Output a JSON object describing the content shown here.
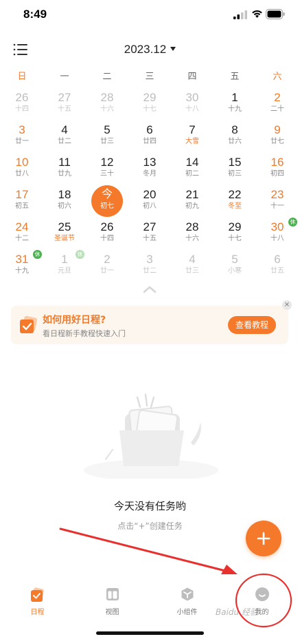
{
  "status_bar": {
    "time": "8:49"
  },
  "header": {
    "month": "2023.12"
  },
  "weekdays": [
    "日",
    "一",
    "二",
    "三",
    "四",
    "五",
    "六"
  ],
  "calendar": {
    "weeks": [
      [
        {
          "day": "26",
          "lunar": "十四",
          "other": true
        },
        {
          "day": "27",
          "lunar": "十五",
          "other": true
        },
        {
          "day": "28",
          "lunar": "十六",
          "other": true
        },
        {
          "day": "29",
          "lunar": "十七",
          "other": true
        },
        {
          "day": "30",
          "lunar": "十八",
          "other": true
        },
        {
          "day": "1",
          "lunar": "十九"
        },
        {
          "day": "2",
          "lunar": "二十"
        }
      ],
      [
        {
          "day": "3",
          "lunar": "廿一"
        },
        {
          "day": "4",
          "lunar": "廿二"
        },
        {
          "day": "5",
          "lunar": "廿三"
        },
        {
          "day": "6",
          "lunar": "廿四"
        },
        {
          "day": "7",
          "lunar": "大雪",
          "festival": true
        },
        {
          "day": "8",
          "lunar": "廿六"
        },
        {
          "day": "9",
          "lunar": "廿七"
        }
      ],
      [
        {
          "day": "10",
          "lunar": "廿八"
        },
        {
          "day": "11",
          "lunar": "廿九"
        },
        {
          "day": "12",
          "lunar": "三十"
        },
        {
          "day": "13",
          "lunar": "冬月"
        },
        {
          "day": "14",
          "lunar": "初二"
        },
        {
          "day": "15",
          "lunar": "初三"
        },
        {
          "day": "16",
          "lunar": "初四"
        }
      ],
      [
        {
          "day": "17",
          "lunar": "初五"
        },
        {
          "day": "18",
          "lunar": "初六"
        },
        {
          "day": "今",
          "lunar": "初七",
          "today": true
        },
        {
          "day": "20",
          "lunar": "初八"
        },
        {
          "day": "21",
          "lunar": "初九"
        },
        {
          "day": "22",
          "lunar": "冬至",
          "festival": true
        },
        {
          "day": "23",
          "lunar": "十一"
        }
      ],
      [
        {
          "day": "24",
          "lunar": "十二"
        },
        {
          "day": "25",
          "lunar": "圣诞节",
          "festival": true
        },
        {
          "day": "26",
          "lunar": "十四"
        },
        {
          "day": "27",
          "lunar": "十五"
        },
        {
          "day": "28",
          "lunar": "十六"
        },
        {
          "day": "29",
          "lunar": "十七"
        },
        {
          "day": "30",
          "lunar": "十八",
          "badge": "休"
        }
      ],
      [
        {
          "day": "31",
          "lunar": "十九",
          "badge": "休"
        },
        {
          "day": "1",
          "lunar": "元旦",
          "other": true,
          "badge": "休"
        },
        {
          "day": "2",
          "lunar": "廿一",
          "other": true
        },
        {
          "day": "3",
          "lunar": "廿二",
          "other": true
        },
        {
          "day": "4",
          "lunar": "廿三",
          "other": true
        },
        {
          "day": "5",
          "lunar": "小寒",
          "other": true
        },
        {
          "day": "6",
          "lunar": "廿五",
          "other": true
        }
      ]
    ]
  },
  "banner": {
    "title": "如何用好日程?",
    "subtitle": "看日程新手教程快速入门",
    "button": "查看教程",
    "close": "×"
  },
  "empty_state": {
    "title": "今天没有任务哟",
    "subtitle": "点击“+”创建任务"
  },
  "tabs": [
    {
      "label": "日程",
      "icon": "schedule-check-icon",
      "active": true
    },
    {
      "label": "视图",
      "icon": "view-layout-icon"
    },
    {
      "label": "小组件",
      "icon": "widget-cube-icon"
    },
    {
      "label": "我的",
      "icon": "profile-smile-icon"
    }
  ],
  "watermark": "Baidu 经验",
  "colors": {
    "accent": "#f4792b",
    "weekend": "#f07a2a",
    "rest_badge": "#4caf50",
    "annotation": "#e8312f"
  }
}
